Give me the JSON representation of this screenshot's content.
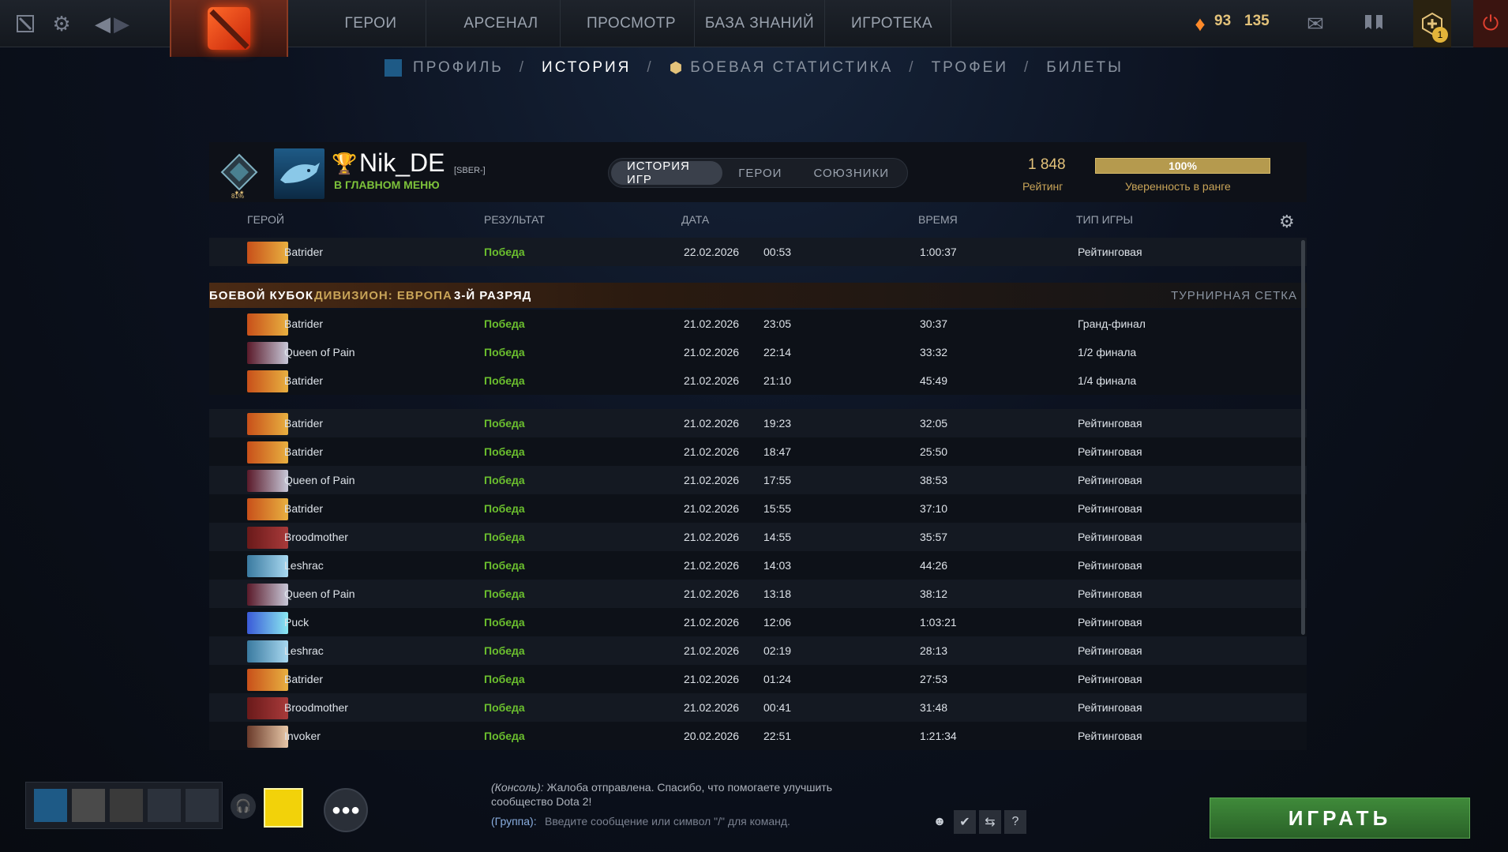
{
  "topbar": {
    "nav": [
      "ГЕРОИ",
      "АРСЕНАЛ",
      "ПРОСМОТР",
      "БАЗА ЗНАНИЙ",
      "ИГРОТЕКА"
    ],
    "shards": "93",
    "coins": "135",
    "notif_count": "1"
  },
  "subnav": {
    "profile": "ПРОФИЛЬ",
    "history": "ИСТОРИЯ",
    "stats": "БОЕВАЯ СТАТИСТИКА",
    "trophies": "ТРОФЕИ",
    "tickets": "БИЛЕТЫ",
    "sep": "/"
  },
  "profile": {
    "rank_pct": "81%",
    "nick": "Nik_DE",
    "tag": "[SBER-]",
    "status": "В ГЛАВНОМ МЕНЮ",
    "tabs": [
      "ИСТОРИЯ ИГР",
      "ГЕРОИ",
      "СОЮЗНИКИ"
    ],
    "rating": "1 848",
    "rating_label": "Рейтинг",
    "confidence": "100%",
    "confidence_fill": 1.0,
    "confidence_label": "Уверенность в ранге"
  },
  "columns": {
    "hero": "ГЕРОЙ",
    "result": "РЕЗУЛЬТАТ",
    "date": "ДАТА",
    "time": "ВРЕМЯ",
    "type": "ТИП ИГРЫ"
  },
  "cup": {
    "title": "БОЕВОЙ КУБОК",
    "division": "ДИВИЗИОН: ЕВРОПА",
    "rank": "3-Й РАЗРЯД",
    "bracket": "ТУРНИРНАЯ СЕТКА"
  },
  "first_match": {
    "hero": "Batrider",
    "result": "Победа",
    "date": "22.02.2026",
    "clock": "00:53",
    "duration": "1:00:37",
    "type": "Рейтинговая"
  },
  "cup_matches": [
    {
      "hero": "Batrider",
      "result": "Победа",
      "date": "21.02.2026",
      "clock": "23:05",
      "duration": "30:37",
      "type": "Гранд-финал"
    },
    {
      "hero": "Queen of Pain",
      "result": "Победа",
      "date": "21.02.2026",
      "clock": "22:14",
      "duration": "33:32",
      "type": "1/2 финала"
    },
    {
      "hero": "Batrider",
      "result": "Победа",
      "date": "21.02.2026",
      "clock": "21:10",
      "duration": "45:49",
      "type": "1/4 финала"
    }
  ],
  "matches": [
    {
      "hero": "Batrider",
      "result": "Победа",
      "date": "21.02.2026",
      "clock": "19:23",
      "duration": "32:05",
      "type": "Рейтинговая"
    },
    {
      "hero": "Batrider",
      "result": "Победа",
      "date": "21.02.2026",
      "clock": "18:47",
      "duration": "25:50",
      "type": "Рейтинговая"
    },
    {
      "hero": "Queen of Pain",
      "result": "Победа",
      "date": "21.02.2026",
      "clock": "17:55",
      "duration": "38:53",
      "type": "Рейтинговая"
    },
    {
      "hero": "Batrider",
      "result": "Победа",
      "date": "21.02.2026",
      "clock": "15:55",
      "duration": "37:10",
      "type": "Рейтинговая"
    },
    {
      "hero": "Broodmother",
      "result": "Победа",
      "date": "21.02.2026",
      "clock": "14:55",
      "duration": "35:57",
      "type": "Рейтинговая"
    },
    {
      "hero": "Leshrac",
      "result": "Победа",
      "date": "21.02.2026",
      "clock": "14:03",
      "duration": "44:26",
      "type": "Рейтинговая"
    },
    {
      "hero": "Queen of Pain",
      "result": "Победа",
      "date": "21.02.2026",
      "clock": "13:18",
      "duration": "38:12",
      "type": "Рейтинговая"
    },
    {
      "hero": "Puck",
      "result": "Победа",
      "date": "21.02.2026",
      "clock": "12:06",
      "duration": "1:03:21",
      "type": "Рейтинговая"
    },
    {
      "hero": "Leshrac",
      "result": "Победа",
      "date": "21.02.2026",
      "clock": "02:19",
      "duration": "28:13",
      "type": "Рейтинговая"
    },
    {
      "hero": "Batrider",
      "result": "Победа",
      "date": "21.02.2026",
      "clock": "01:24",
      "duration": "27:53",
      "type": "Рейтинговая"
    },
    {
      "hero": "Broodmother",
      "result": "Победа",
      "date": "21.02.2026",
      "clock": "00:41",
      "duration": "31:48",
      "type": "Рейтинговая"
    },
    {
      "hero": "Invoker",
      "result": "Победа",
      "date": "20.02.2026",
      "clock": "22:51",
      "duration": "1:21:34",
      "type": "Рейтинговая"
    }
  ],
  "chat": {
    "console_prefix": "(Консоль):",
    "console_msg": "Жалоба отправлена. Спасибо, что помогаете улучшить сообщество Dota 2!",
    "group_label": "(Группа):",
    "placeholder": "Введите сообщение или символ \"/\" для команд.",
    "help": "?"
  },
  "play": "ИГРАТЬ"
}
